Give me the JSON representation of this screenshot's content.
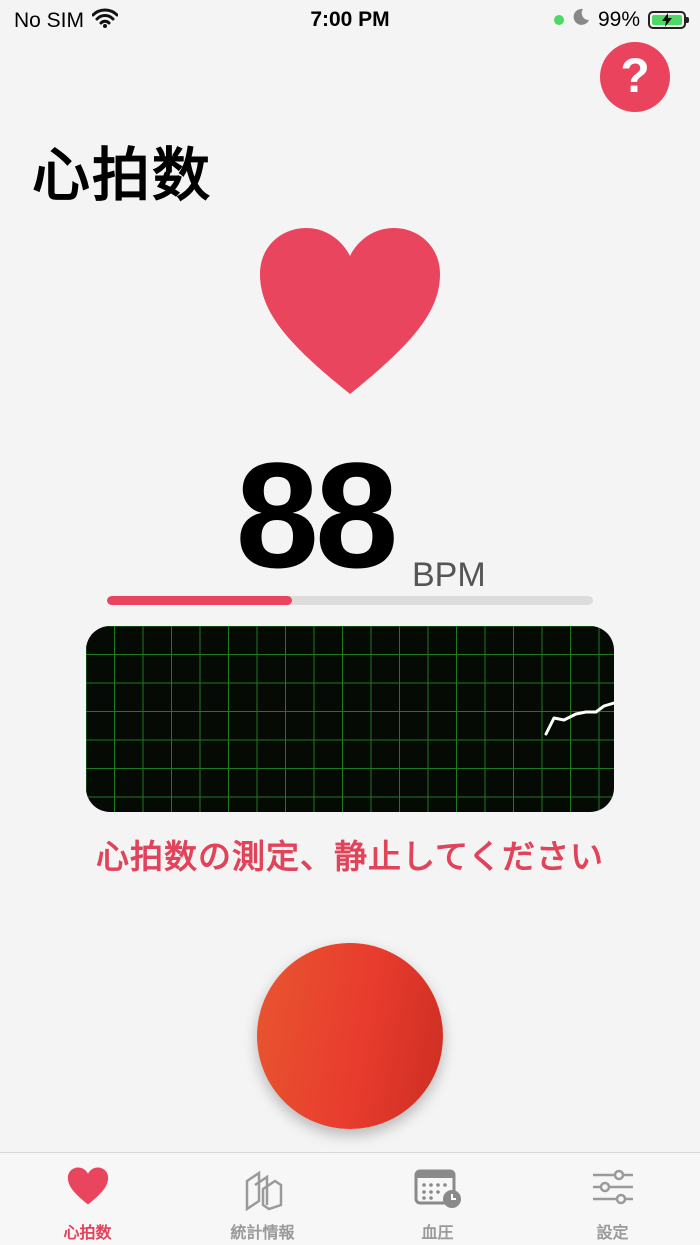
{
  "status_bar": {
    "carrier": "No SIM",
    "time": "7:00 PM",
    "battery": "99%",
    "icons": [
      "wifi-icon",
      "location-dot-icon",
      "moon-icon",
      "battery-charging-icon"
    ]
  },
  "header": {
    "title": "心拍数",
    "help_label": "?"
  },
  "measurement": {
    "value": "88",
    "unit": "BPM",
    "progress": 0.38,
    "message": "心拍数の測定、静止してください"
  },
  "colors": {
    "accent": "#e9435e",
    "record_button": "#e83c2e",
    "graph_background": "#050a05",
    "graph_grid": "#1f7a1f",
    "trace": "#ffffff"
  },
  "tabs": [
    {
      "label": "心拍数",
      "icon": "heart-icon",
      "active": true
    },
    {
      "label": "統計情報",
      "icon": "stats-pages-icon",
      "active": false
    },
    {
      "label": "血圧",
      "icon": "calendar-clock-icon",
      "active": false
    },
    {
      "label": "設定",
      "icon": "sliders-icon",
      "active": false
    }
  ]
}
